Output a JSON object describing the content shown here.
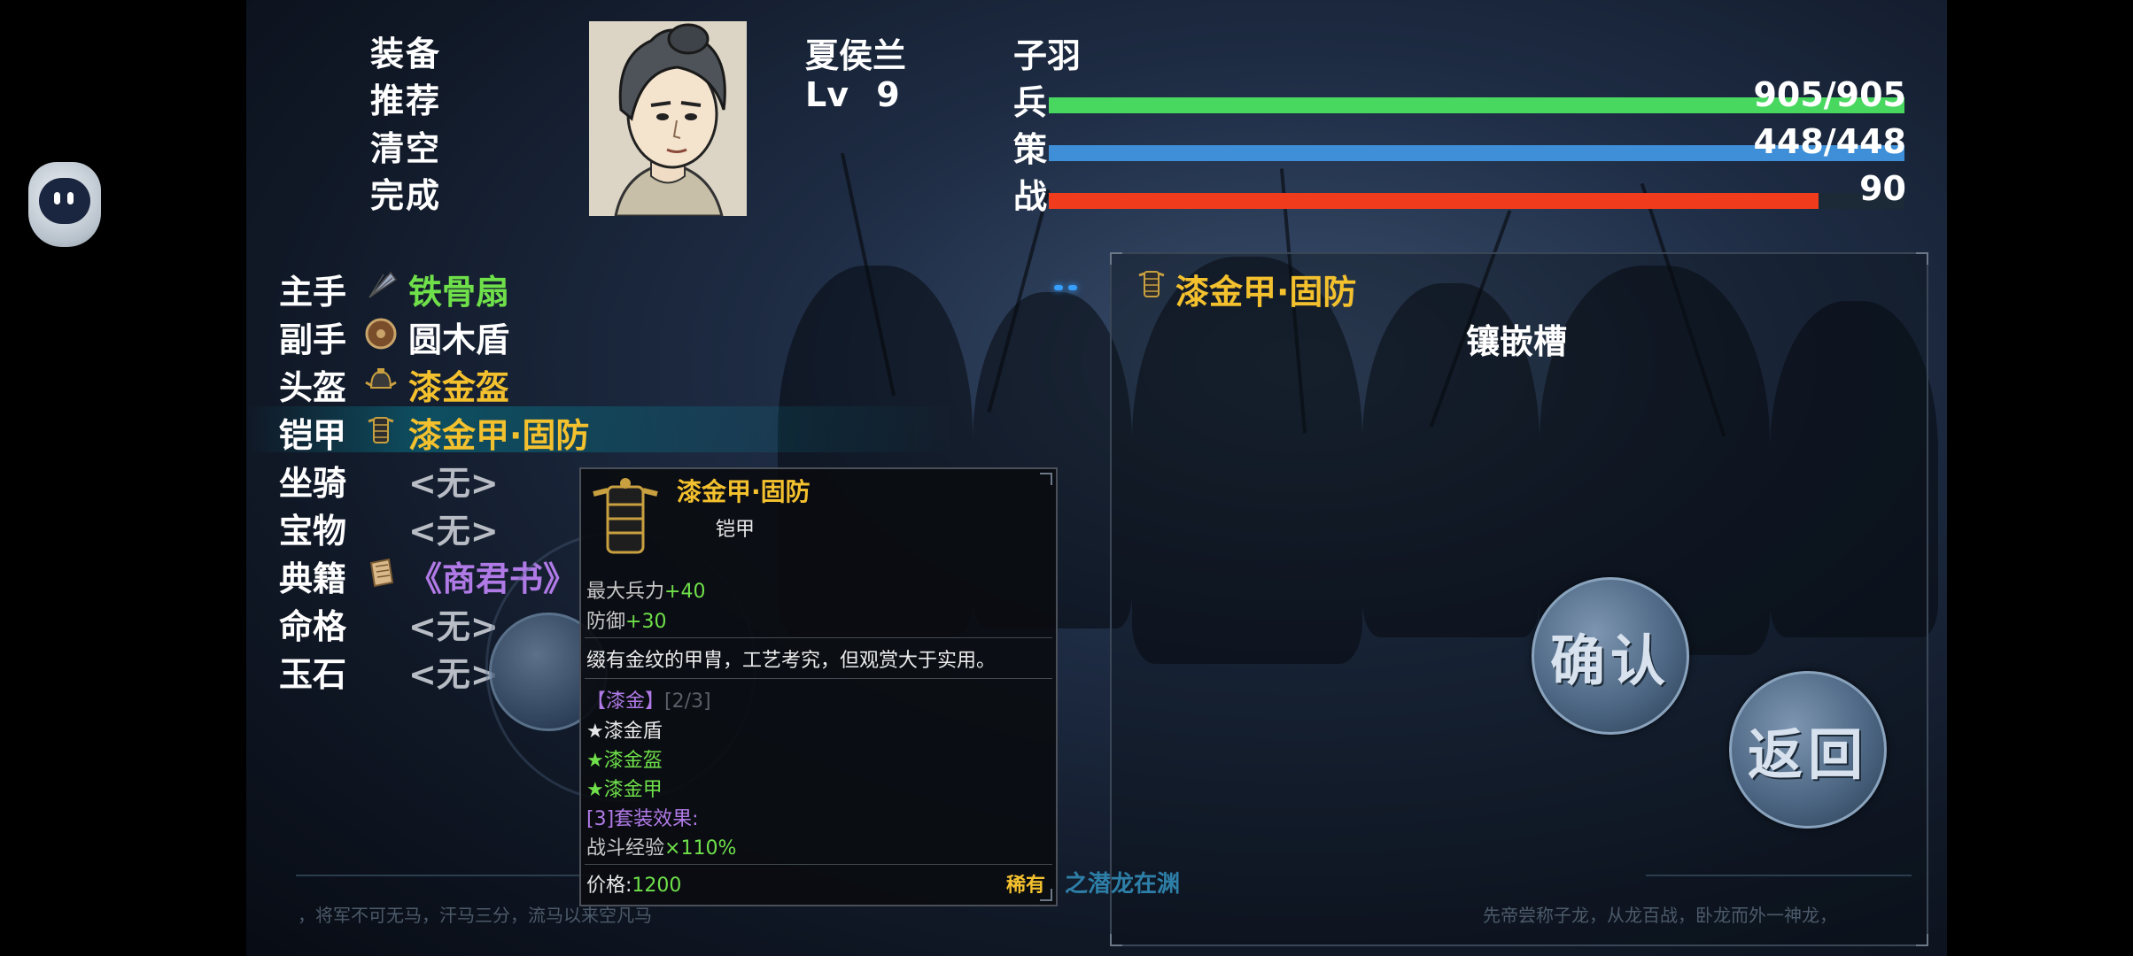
{
  "colors": {
    "troops_bar": "#48d860",
    "strategy_bar": "#3e8fd8",
    "battle_bar": "#f03c1c",
    "rare_gold": "#f4c12e",
    "common_green": "#6fe04a",
    "book_purple": "#b07ae6"
  },
  "menu": {
    "items": [
      "装备",
      "推荐",
      "清空",
      "完成"
    ],
    "active_index": 0
  },
  "general": {
    "name": "夏侯兰",
    "style_name": "子羽",
    "level_label": "Lv",
    "level_value": "9"
  },
  "stats": {
    "troops": {
      "label": "兵",
      "value": "905/905",
      "fill": 1.0
    },
    "strategy": {
      "label": "策",
      "value": "448/448",
      "fill": 1.0
    },
    "battle": {
      "label": "战",
      "value": "90",
      "fill": 0.9
    }
  },
  "slots": [
    {
      "label": "主手",
      "icon": "fan-icon",
      "value": "铁骨扇",
      "color": "#6fe04a"
    },
    {
      "label": "副手",
      "icon": "round-shield-icon",
      "value": "圆木盾",
      "color": "#ffffff"
    },
    {
      "label": "头盔",
      "icon": "helmet-icon",
      "value": "漆金盔",
      "color": "#f4c12e"
    },
    {
      "label": "铠甲",
      "icon": "armor-icon",
      "value": "漆金甲·固防",
      "color": "#f4c12e"
    },
    {
      "label": "坐骑",
      "icon": "",
      "value": "<无>",
      "color": "#b8bcc4"
    },
    {
      "label": "宝物",
      "icon": "",
      "value": "<无>",
      "color": "#b8bcc4"
    },
    {
      "label": "典籍",
      "icon": "scroll-icon",
      "value": "《商君书》",
      "color": "#b07ae6"
    },
    {
      "label": "命格",
      "icon": "",
      "value": "<无>",
      "color": "#b8bcc4"
    },
    {
      "label": "玉石",
      "icon": "",
      "value": "<无>",
      "color": "#b8bcc4"
    }
  ],
  "selected_slot_index": 3,
  "right_panel": {
    "item_name": "漆金甲·固防",
    "section_title": "镶嵌槽",
    "confirm_label": "确认",
    "back_label": "返回"
  },
  "tooltip": {
    "name": "漆金甲·固防",
    "type": "铠甲",
    "stats": [
      {
        "label": "最大兵力",
        "bonus": "+40"
      },
      {
        "label": "防御",
        "bonus": "+30"
      }
    ],
    "description": "缀有金纹的甲胄，工艺考究，但观赏大于实用。",
    "set_name": "【漆金】",
    "set_progress": "[2/3]",
    "set_items": [
      {
        "name": "★漆金盾",
        "owned": false
      },
      {
        "name": "★漆金盔",
        "owned": true
      },
      {
        "name": "★漆金甲",
        "owned": true
      }
    ],
    "set_effect_label": "[3]套装效果:",
    "set_effect_value_label": "战斗经验",
    "set_effect_value": "×110%",
    "price_label": "价格:",
    "price": "1200",
    "rarity": "稀有"
  },
  "quotes": {
    "left": "，将军不可无马，汗马三分，流马以来空凡马",
    "center": "之潜龙在渊",
    "right": "先帝尝称子龙，从龙百战，卧龙而外一神龙，"
  }
}
